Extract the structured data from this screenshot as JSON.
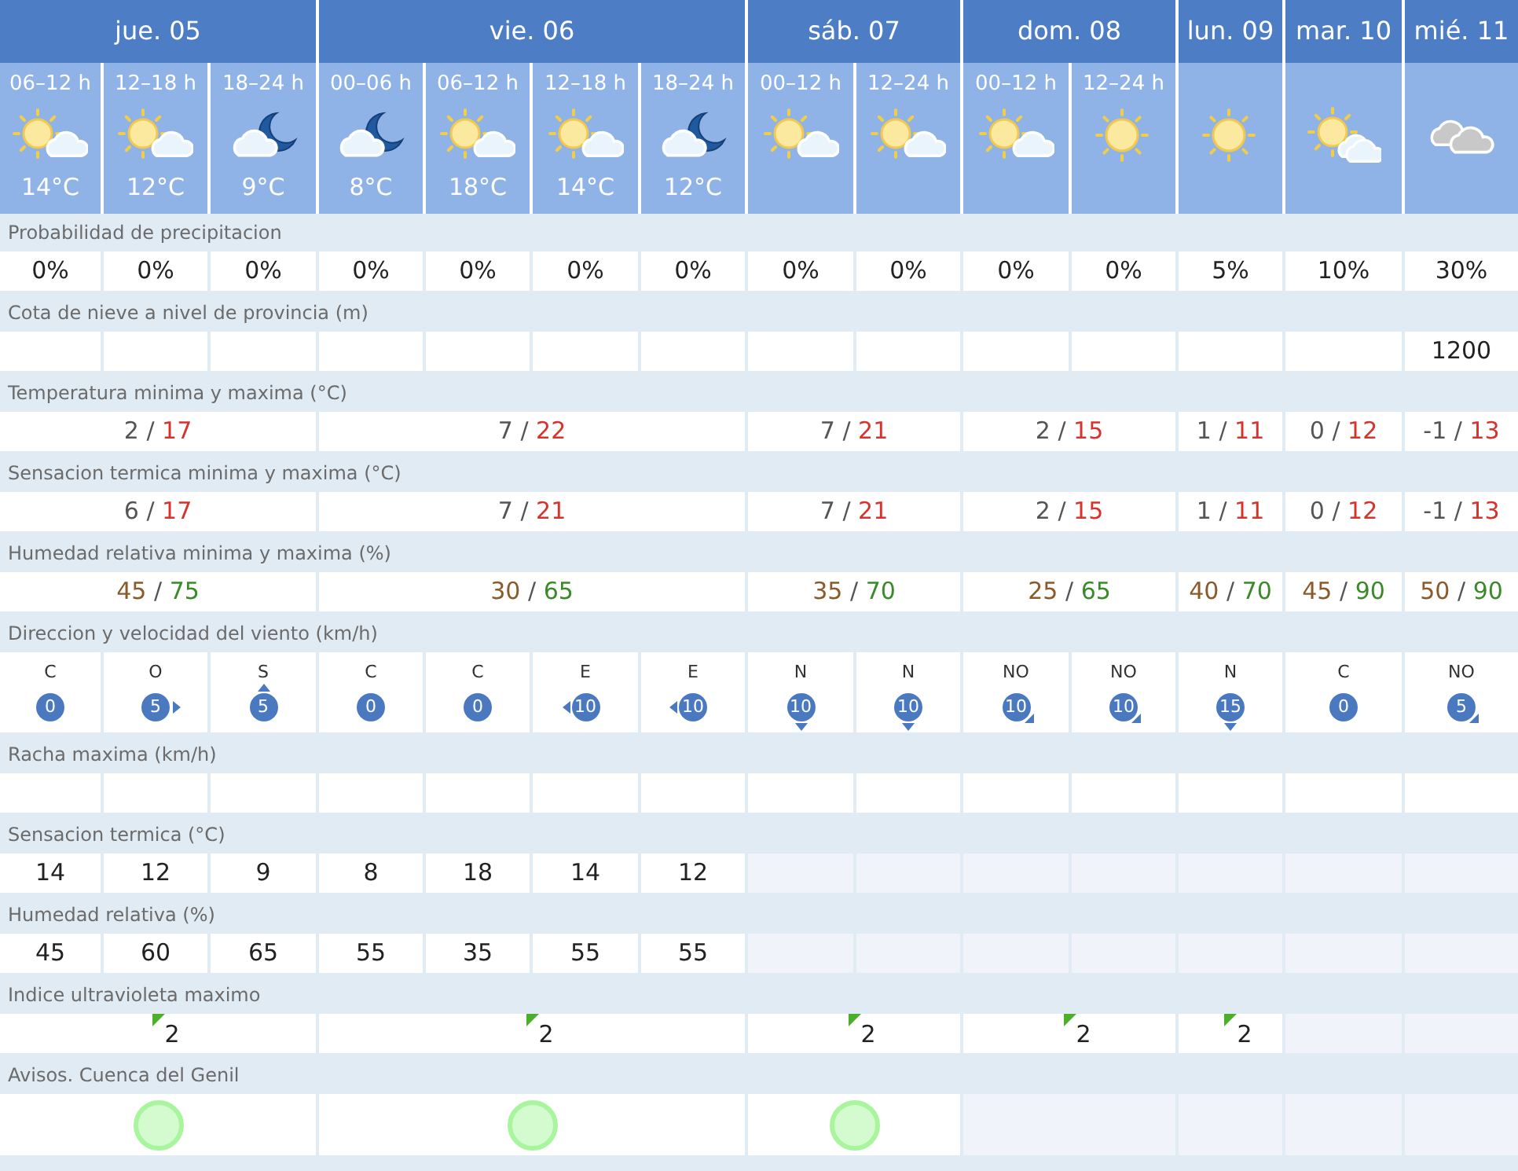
{
  "days": [
    {
      "label": "jue. 05",
      "periods": [
        {
          "time": "06–12 h",
          "kind": "sun_cloud",
          "temp": "14°C"
        },
        {
          "time": "12–18 h",
          "kind": "sun_cloud",
          "temp": "12°C"
        },
        {
          "time": "18–24 h",
          "kind": "moon_cloud",
          "temp": "9°C"
        }
      ]
    },
    {
      "label": "vie. 06",
      "periods": [
        {
          "time": "00–06 h",
          "kind": "moon_cloud",
          "temp": "8°C"
        },
        {
          "time": "06–12 h",
          "kind": "sun_cloud",
          "temp": "18°C"
        },
        {
          "time": "12–18 h",
          "kind": "sun_cloud",
          "temp": "14°C"
        },
        {
          "time": "18–24 h",
          "kind": "moon_cloud",
          "temp": "12°C"
        }
      ]
    },
    {
      "label": "sáb. 07",
      "periods": [
        {
          "time": "00–12 h",
          "kind": "sun_cloud"
        },
        {
          "time": "12–24 h",
          "kind": "sun_cloud"
        }
      ]
    },
    {
      "label": "dom. 08",
      "periods": [
        {
          "time": "00–12 h",
          "kind": "sun_cloud"
        },
        {
          "time": "12–24 h",
          "kind": "sun"
        }
      ]
    },
    {
      "label": "lun. 09",
      "periods": [
        {
          "kind": "sun"
        }
      ]
    },
    {
      "label": "mar. 10",
      "periods": [
        {
          "kind": "sun_clouds"
        }
      ]
    },
    {
      "label": "mié. 11",
      "periods": [
        {
          "kind": "clouds"
        }
      ]
    }
  ],
  "sections": [
    {
      "title": "Probabilidad de precipitacion",
      "kind": "period",
      "cells": [
        {
          "value": "0%"
        },
        {
          "value": "0%"
        },
        {
          "value": "0%"
        },
        {
          "value": "0%"
        },
        {
          "value": "0%"
        },
        {
          "value": "0%"
        },
        {
          "value": "0%"
        },
        {
          "value": "0%"
        },
        {
          "value": "0%"
        },
        {
          "value": "0%"
        },
        {
          "value": "0%"
        },
        {
          "value": "5%"
        },
        {
          "value": "10%"
        },
        {
          "value": "30%"
        }
      ]
    },
    {
      "title": "Cota de nieve a nivel de provincia (m)",
      "kind": "period",
      "cells": [
        {},
        {},
        {},
        {},
        {},
        {},
        {},
        {},
        {},
        {},
        {},
        {},
        {},
        {
          "value": "1200"
        }
      ]
    },
    {
      "title": "Temperatura minima y maxima (°C)",
      "kind": "minmax",
      "cells": [
        {
          "min": "2",
          "separator": "/",
          "max": "17"
        },
        {
          "min": "7",
          "separator": "/",
          "max": "22"
        },
        {
          "min": "7",
          "separator": "/",
          "max": "21"
        },
        {
          "min": "2",
          "separator": "/",
          "max": "15"
        },
        {
          "min": "1",
          "separator": "/",
          "max": "11"
        },
        {
          "min": "0",
          "separator": "/",
          "max": "12"
        },
        {
          "min": "-1",
          "separator": "/",
          "max": "13"
        }
      ]
    },
    {
      "title": "Sensacion termica minima y maxima (°C)",
      "kind": "minmax",
      "cells": [
        {
          "min": "6",
          "separator": "/",
          "max": "17"
        },
        {
          "min": "7",
          "separator": "/",
          "max": "21"
        },
        {
          "min": "7",
          "separator": "/",
          "max": "21"
        },
        {
          "min": "2",
          "separator": "/",
          "max": "15"
        },
        {
          "min": "1",
          "separator": "/",
          "max": "11"
        },
        {
          "min": "0",
          "separator": "/",
          "max": "12"
        },
        {
          "min": "-1",
          "separator": "/",
          "max": "13"
        }
      ]
    },
    {
      "title": "Humedad relativa minima y maxima (%)",
      "kind": "humidity",
      "cells": [
        {
          "min": "45",
          "separator": "/",
          "max": "75"
        },
        {
          "min": "30",
          "separator": "/",
          "max": "65"
        },
        {
          "min": "35",
          "separator": "/",
          "max": "70"
        },
        {
          "min": "25",
          "separator": "/",
          "max": "65"
        },
        {
          "min": "40",
          "separator": "/",
          "max": "70"
        },
        {
          "min": "45",
          "separator": "/",
          "max": "90"
        },
        {
          "min": "50",
          "separator": "/",
          "max": "90"
        }
      ]
    },
    {
      "title": "Direccion y velocidad del viento (km/h)",
      "kind": "wind",
      "cells": [
        {
          "dir": "C",
          "speed": "0",
          "kind": "none"
        },
        {
          "dir": "O",
          "speed": "5",
          "kind": "right"
        },
        {
          "dir": "S",
          "speed": "5",
          "kind": "up"
        },
        {
          "dir": "C",
          "speed": "0",
          "kind": "none"
        },
        {
          "dir": "C",
          "speed": "0",
          "kind": "none"
        },
        {
          "dir": "E",
          "speed": "10",
          "kind": "left"
        },
        {
          "dir": "E",
          "speed": "10",
          "kind": "left"
        },
        {
          "dir": "N",
          "speed": "10",
          "kind": "down"
        },
        {
          "dir": "N",
          "speed": "10",
          "kind": "down"
        },
        {
          "dir": "NO",
          "speed": "10",
          "kind": "downright"
        },
        {
          "dir": "NO",
          "speed": "10",
          "kind": "downright"
        },
        {
          "dir": "N",
          "speed": "15",
          "kind": "down"
        },
        {
          "dir": "C",
          "speed": "0",
          "kind": "none"
        },
        {
          "dir": "NO",
          "speed": "5",
          "kind": "downright"
        }
      ]
    },
    {
      "title": "Racha maxima (km/h)",
      "kind": "period",
      "cells": [
        {},
        {},
        {},
        {},
        {},
        {},
        {},
        {},
        {},
        {},
        {},
        {},
        {},
        {}
      ]
    },
    {
      "title": "Sensacion termica (°C)",
      "kind": "period",
      "cells": [
        {
          "value": "14",
          "available": true
        },
        {
          "value": "12",
          "available": true
        },
        {
          "value": "9",
          "available": true
        },
        {
          "value": "8",
          "available": true
        },
        {
          "value": "18",
          "available": true
        },
        {
          "value": "14",
          "available": true
        },
        {
          "value": "12",
          "available": true
        },
        {
          "available": false
        },
        {
          "available": false
        },
        {
          "available": false
        },
        {
          "available": false
        },
        {
          "available": false
        },
        {
          "available": false
        },
        {
          "available": false
        }
      ]
    },
    {
      "title": "Humedad relativa (%)",
      "kind": "period",
      "cells": [
        {
          "value": "45",
          "available": true
        },
        {
          "value": "60",
          "available": true
        },
        {
          "value": "65",
          "available": true
        },
        {
          "value": "55",
          "available": true
        },
        {
          "value": "35",
          "available": true
        },
        {
          "value": "55",
          "available": true
        },
        {
          "value": "55",
          "available": true
        },
        {
          "available": false
        },
        {
          "available": false
        },
        {
          "available": false
        },
        {
          "available": false
        },
        {
          "available": false
        },
        {
          "available": false
        },
        {
          "available": false
        }
      ]
    },
    {
      "title": "Indice ultravioleta maximo",
      "kind": "uv",
      "cells": [
        {
          "value": "2",
          "color": "#4caf2a",
          "available": true
        },
        {
          "value": "2",
          "color": "#4caf2a",
          "available": true
        },
        {
          "value": "2",
          "color": "#4caf2a",
          "available": true
        },
        {
          "value": "2",
          "color": "#4caf2a",
          "available": true
        },
        {
          "value": "2",
          "color": "#4caf2a",
          "available": true
        },
        {
          "available": false
        },
        {
          "available": false
        }
      ]
    },
    {
      "title": "Avisos. Cuenca del Genil",
      "kind": "warning",
      "cells": [
        {
          "color": "#a8f59e",
          "available": true
        },
        {
          "color": "#a8f59e",
          "available": true
        },
        {
          "color": "#a8f59e",
          "available": true
        },
        {
          "available": false
        },
        {
          "available": false
        },
        {
          "available": false
        },
        {
          "available": false
        }
      ]
    }
  ]
}
